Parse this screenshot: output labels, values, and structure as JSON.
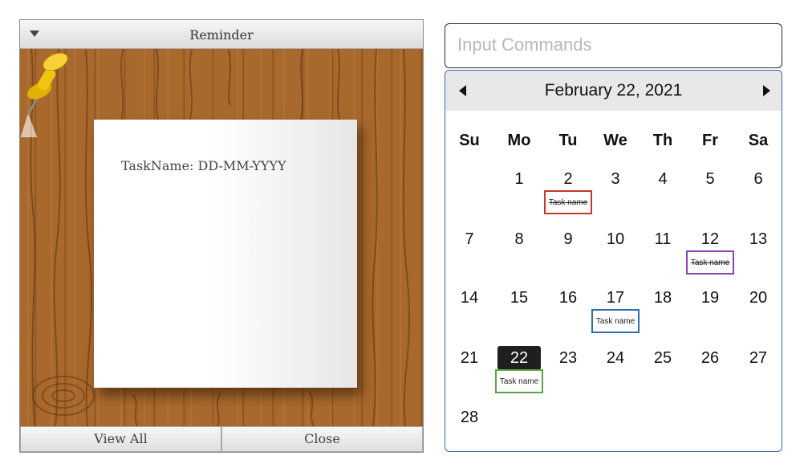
{
  "reminder": {
    "title": "Reminder",
    "note_text": "TaskName: DD-MM-YYYY",
    "buttons": {
      "view_all": "View All",
      "close": "Close"
    }
  },
  "command_input": {
    "placeholder": "Input Commands"
  },
  "calendar": {
    "month_label": "February 22, 2021",
    "weekdays": [
      "Su",
      "Mo",
      "Tu",
      "We",
      "Th",
      "Fr",
      "Sa"
    ],
    "days": [
      "1",
      "2",
      "3",
      "4",
      "5",
      "6",
      "7",
      "8",
      "9",
      "10",
      "11",
      "12",
      "13",
      "14",
      "15",
      "16",
      "17",
      "18",
      "19",
      "20",
      "21",
      "22",
      "23",
      "24",
      "25",
      "26",
      "27",
      "28"
    ],
    "selected_day": "22",
    "tasks": [
      {
        "day": "2",
        "label": "Task name",
        "completed": true,
        "color": "#c0392b"
      },
      {
        "day": "12",
        "label": "Task name",
        "completed": true,
        "color": "#8e44ad"
      },
      {
        "day": "17",
        "label": "Task name",
        "completed": false,
        "color": "#2e6db4"
      },
      {
        "day": "22",
        "label": "Task name",
        "completed": false,
        "color": "#5aa642"
      }
    ]
  },
  "colors": {
    "wood": "#a9692c",
    "calendar_border": "#3b63b0",
    "selected_day_bg": "#1f1f1f",
    "pin": "#f2c40f"
  }
}
